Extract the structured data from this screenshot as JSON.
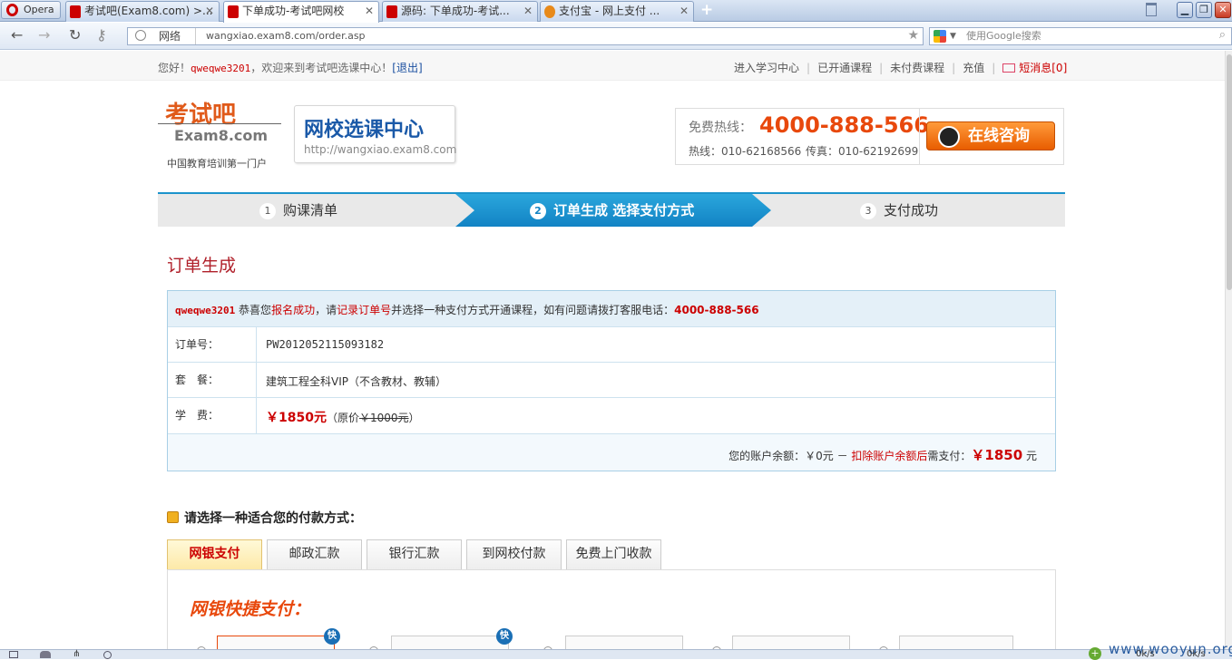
{
  "browser": {
    "opera_label": "Opera",
    "tabs": [
      {
        "title": "考试吧(Exam8.com) >..."
      },
      {
        "title": "下单成功-考试吧网校"
      },
      {
        "title": "源码: 下单成功-考试..."
      },
      {
        "title": "支付宝 - 网上支付 ..."
      }
    ],
    "new_tab": "+",
    "address_prefix": "网络",
    "url": "wangxiao.exam8.com/order.asp",
    "search_placeholder": "使用Google搜索"
  },
  "topbar": {
    "greeting": "您好！",
    "username": "qweqwe3201",
    "welcome": "，欢迎来到考试吧选课中心！",
    "logout": "[退出]",
    "links": [
      "进入学习中心",
      "已开通课程",
      "未付费课程",
      "充值"
    ],
    "message": "短消息[0]"
  },
  "header": {
    "logo_text": "考试吧",
    "logo_domain": "Exam8.com",
    "slogan": "中国教育培训第一门户",
    "brand_title": "网校选课中心",
    "brand_url": "http://wangxiao.exam8.com",
    "hotline_label": "免费热线：",
    "hotline_number": "4000-888-566",
    "hotline_sub": "热线：010-62168566",
    "fax": "传真：010-62192699",
    "consult_button": "在线咨询"
  },
  "steps": [
    {
      "num": "1",
      "label": "购课清单"
    },
    {
      "num": "2",
      "label": "订单生成  选择支付方式"
    },
    {
      "num": "3",
      "label": "支付成功"
    }
  ],
  "order": {
    "title": "订单生成",
    "notice_user": "qweqwe3201",
    "notice_1": " 恭喜您",
    "notice_2": "报名成功",
    "notice_3": "，请",
    "notice_4": "记录订单号",
    "notice_5": "并选择一种支付方式开通课程，如有问题请拨打客服电话：",
    "notice_phone": "4000-888-566",
    "order_no_label": "订单号：",
    "order_no": "PW2012052115093182",
    "package_label": "套　餐：",
    "package": "建筑工程全科VIP（不含教材、教辅）",
    "fee_label": "学　费：",
    "fee": "￥1850元",
    "fee_orig_prefix": "（原价",
    "fee_orig": "￥1000元",
    "fee_orig_suffix": "）",
    "balance_1": "您的账户余额：￥0元 － ",
    "balance_2": "扣除账户余额后",
    "balance_3": "需支付：",
    "balance_amount": "￥1850",
    "balance_unit": " 元"
  },
  "payment": {
    "title": "请选择一种适合您的付款方式：",
    "tabs": [
      "网银支付",
      "邮政汇款",
      "银行汇款",
      "到网校付款",
      "免费上门收款"
    ],
    "section_title": "网银快捷支付：",
    "kuai": "快"
  },
  "statusbar": {
    "watermark": "www.wooyun.org",
    "speed": "0k/s"
  },
  "colors": {
    "accent_blue": "#1c93cc",
    "brand_red": "#c00000",
    "hotline_orange": "#e8480c"
  }
}
